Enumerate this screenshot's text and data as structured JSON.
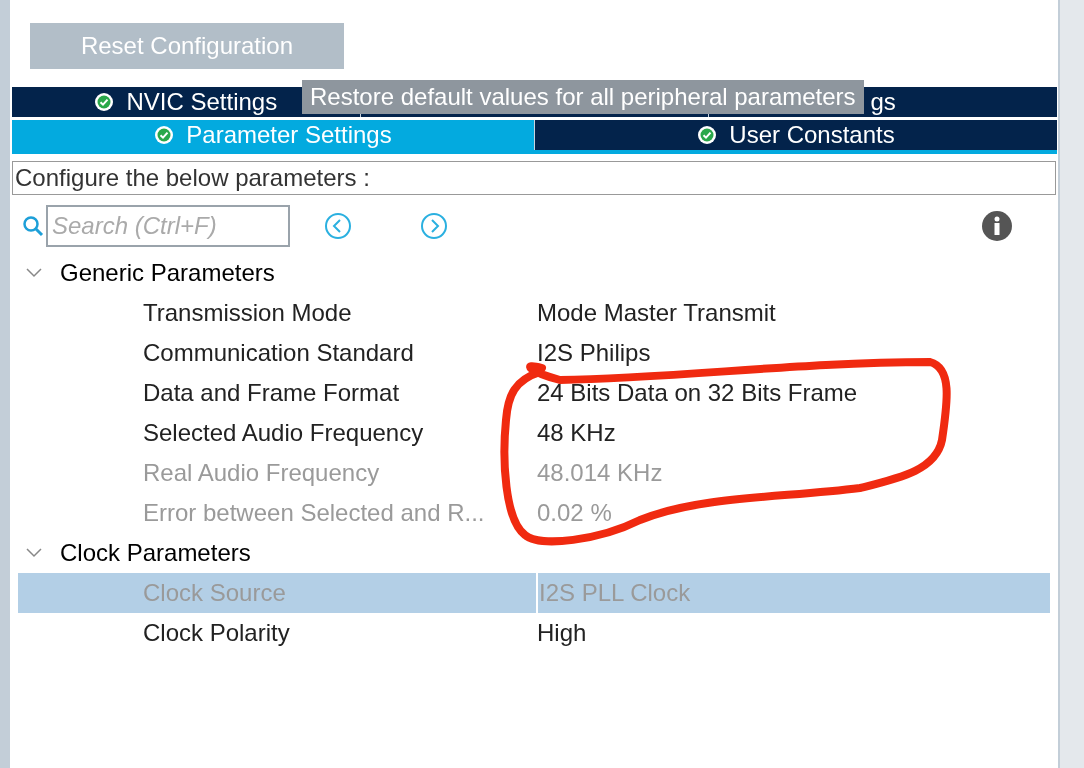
{
  "reset_button": {
    "label": "Reset Configuration"
  },
  "tooltip": {
    "text": "Restore default values for all peripheral parameters"
  },
  "tab_rows": [
    {
      "tabs": [
        {
          "label": "NVIC Settings",
          "check": true,
          "selected": false
        },
        {
          "selected": false
        },
        {
          "label": "gs",
          "selected": false
        }
      ]
    },
    {
      "tabs": [
        {
          "label": "Parameter Settings",
          "check": true,
          "selected": true
        },
        {
          "label": "User Constants",
          "check": true,
          "selected": false
        }
      ]
    }
  ],
  "hint": "Configure the below parameters :",
  "search": {
    "placeholder": "Search (Ctrl+F)"
  },
  "groups": [
    {
      "title": "Generic Parameters",
      "expanded": true,
      "rows": [
        {
          "name": "Transmission Mode",
          "value": "Mode Master Transmit",
          "disabled": false,
          "selected": false
        },
        {
          "name": "Communication Standard",
          "value": "I2S Philips",
          "disabled": false,
          "selected": false
        },
        {
          "name": "Data and Frame Format",
          "value": "24 Bits Data on 32 Bits Frame",
          "disabled": false,
          "selected": false
        },
        {
          "name": "Selected Audio Frequency",
          "value": "48 KHz",
          "disabled": false,
          "selected": false
        },
        {
          "name": "Real Audio Frequency",
          "value": "48.014 KHz",
          "disabled": true,
          "selected": false
        },
        {
          "name": "Error between Selected and R...",
          "value": "0.02 %",
          "disabled": true,
          "selected": false
        }
      ]
    },
    {
      "title": "Clock Parameters",
      "expanded": true,
      "rows": [
        {
          "name": "Clock Source",
          "value": "I2S PLL Clock",
          "disabled": true,
          "selected": true
        },
        {
          "name": "Clock Polarity",
          "value": "High",
          "disabled": false,
          "selected": false
        }
      ]
    }
  ],
  "annotation": {
    "kind": "freehand_loop",
    "color": "#f02a10"
  }
}
